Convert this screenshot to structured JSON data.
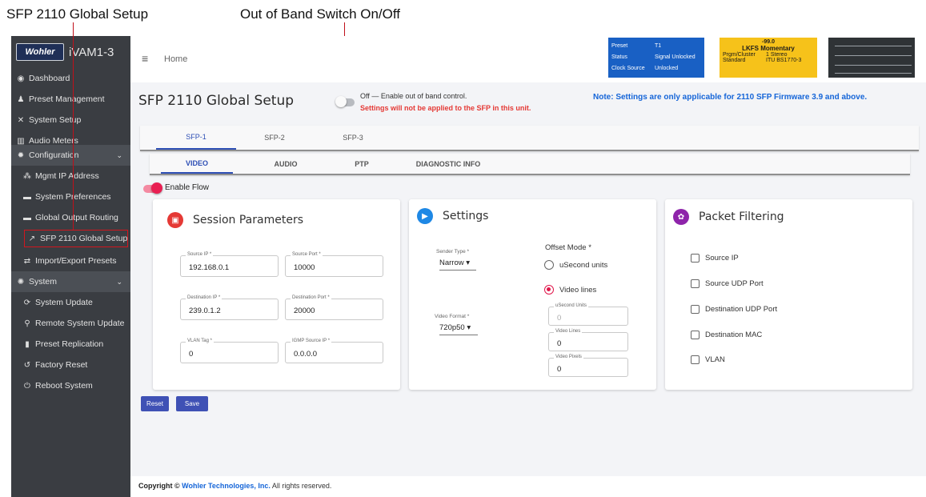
{
  "callouts": {
    "left": "SFP 2110 Global Setup",
    "right": "Out of Band Switch On/Off",
    "line_color": "#c0101a"
  },
  "brand": {
    "logo": "Wohler",
    "name": "iVAM1-3"
  },
  "sidebar": {
    "items": [
      {
        "label": "Dashboard",
        "icon": "dashboard-icon"
      },
      {
        "label": "Preset Management",
        "icon": "users-icon"
      },
      {
        "label": "System Setup",
        "icon": "tools-icon"
      },
      {
        "label": "Audio Meters",
        "icon": "meter-icon"
      },
      {
        "label": "Configuration",
        "icon": "gear-icon"
      },
      {
        "label": "Mgmt IP Address",
        "icon": "network-icon"
      },
      {
        "label": "System Preferences",
        "icon": "keyboard-icon"
      },
      {
        "label": "Global Output Routing",
        "icon": "routing-icon"
      },
      {
        "label": "SFP 2110 Global Setup",
        "icon": "wrench-icon"
      },
      {
        "label": "Import/Export Presets",
        "icon": "swap-icon"
      },
      {
        "label": "System",
        "icon": "gears-icon"
      },
      {
        "label": "System Update",
        "icon": "sync-icon"
      },
      {
        "label": "Remote System Update",
        "icon": "satellite-icon"
      },
      {
        "label": "Preset Replication",
        "icon": "copy-icon"
      },
      {
        "label": "Factory Reset",
        "icon": "undo-icon"
      },
      {
        "label": "Reboot System",
        "icon": "power-icon"
      }
    ]
  },
  "header": {
    "breadcrumb": "Home",
    "status": {
      "preset_key": "Preset",
      "preset_val": "T1",
      "status_key": "Status",
      "status_val": "Signal Unlocked",
      "clock_key": "Clock Source",
      "clock_val": "Unlocked"
    },
    "loudness": {
      "value": "-99.0",
      "mode": "LKFS  Momentary",
      "prgm_key": "Prgm/Cluster",
      "prgm_val": "1  Stereo",
      "std_key": "Standard",
      "std_val": "ITU BS1770-3"
    }
  },
  "page": {
    "title": "SFP 2110 Global Setup",
    "oob_label": "Off — Enable out of band control.",
    "oob_warning": "Settings will not be applied to the SFP in this unit.",
    "note": "Note: Settings are only applicable for 2110 SFP Firmware 3.9 and above.",
    "sfp_tabs": [
      "SFP-1",
      "SFP-2",
      "SFP-3"
    ],
    "sub_tabs": [
      "VIDEO",
      "AUDIO",
      "PTP",
      "DIAGNOSTIC INFO"
    ],
    "enable_flow": "Enable Flow"
  },
  "session": {
    "title": "Session Parameters",
    "fields": [
      {
        "label": "Source IP *",
        "value": "192.168.0.1"
      },
      {
        "label": "Source Port *",
        "value": "10000"
      },
      {
        "label": "Destination IP *",
        "value": "239.0.1.2"
      },
      {
        "label": "Destination Port *",
        "value": "20000"
      },
      {
        "label": "VLAN Tag *",
        "value": "0"
      },
      {
        "label": "IGMP Source IP *",
        "value": "0.0.0.0"
      }
    ]
  },
  "settings": {
    "title": "Settings",
    "sender_type_label": "Sender Type *",
    "sender_type": "Narrow",
    "video_format_label": "Video Format *",
    "video_format": "720p50",
    "offset_mode_label": "Offset Mode *",
    "radio_usecond": "uSecond units",
    "radio_video_lines": "Video lines",
    "usecond_units_label": "uSecond Units",
    "usecond_units": "0",
    "video_lines_label": "Video Lines",
    "video_lines": "0",
    "video_pixels_label": "Video Pixels",
    "video_pixels": "0"
  },
  "filtering": {
    "title": "Packet Filtering",
    "options": [
      "Source IP",
      "Source UDP Port",
      "Destination UDP Port",
      "Destination MAC",
      "VLAN"
    ]
  },
  "actions": {
    "reset": "Reset",
    "save": "Save"
  },
  "footer": {
    "prefix": "Copyright ©",
    "company": "Wohler Technologies, Inc.",
    "suffix": "All rights reserved."
  },
  "colors": {
    "sidebar": "#3a3d42",
    "accent_blue": "#3f51b5",
    "note_blue": "#1565d8",
    "warning_red": "#e53935",
    "toggle_pink": "#e91e52",
    "status_blue": "#1960c4",
    "loudness_yellow": "#f6c21a"
  }
}
